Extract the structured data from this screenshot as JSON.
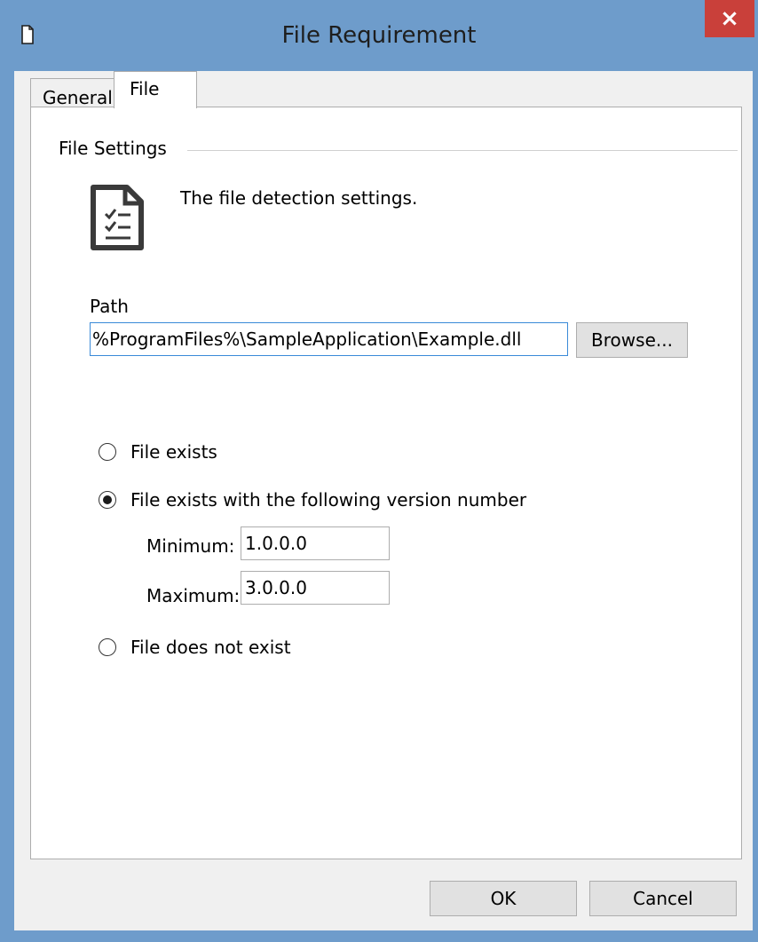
{
  "window": {
    "title": "File Requirement",
    "close_glyph": "×",
    "icon": "document-icon"
  },
  "tabs": [
    {
      "label": "General",
      "active": false
    },
    {
      "label": "File",
      "active": true
    }
  ],
  "section": {
    "title": "File Settings",
    "description": "The file detection settings.",
    "icon": "checklist-document-icon"
  },
  "path": {
    "label": "Path",
    "value": "%ProgramFiles%\\SampleApplication\\Example.dll",
    "browse_label": "Browse..."
  },
  "options": [
    {
      "label": "File exists",
      "checked": false
    },
    {
      "label": "File exists with the following version number",
      "checked": true
    },
    {
      "label": "File does not exist",
      "checked": false
    }
  ],
  "version": {
    "min_label": "Minimum:",
    "min_value": "1.0.0.0",
    "max_label": "Maximum:",
    "max_value": "3.0.0.0"
  },
  "footer": {
    "ok_label": "OK",
    "cancel_label": "Cancel"
  },
  "colors": {
    "titlebar": "#6e9ccb",
    "close_button": "#c9403a",
    "focus_border": "#3a8ad8"
  }
}
